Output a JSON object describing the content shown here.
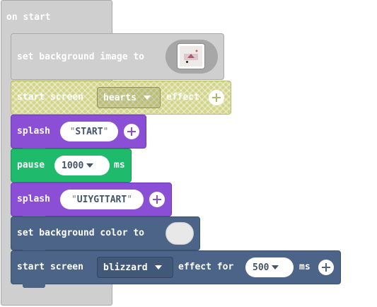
{
  "hat": {
    "label": "on start"
  },
  "blocks": {
    "set_bg_image": {
      "label": "set background image to"
    },
    "start_screen_1": {
      "label": "start screen",
      "effect_value": "hearts",
      "suffix": "effect"
    },
    "splash_1": {
      "label": "splash",
      "value": "START"
    },
    "pause": {
      "label": "pause",
      "value": "1000",
      "unit": "ms"
    },
    "splash_2": {
      "label": "splash",
      "value": "UIYGTTART"
    },
    "set_bg_color": {
      "label": "set background color to"
    },
    "start_screen_2": {
      "label": "start screen",
      "effect_value": "blizzard",
      "middle": "effect for",
      "duration_value": "500",
      "unit": "ms"
    }
  },
  "colors": {
    "gray": "#cfcfcf",
    "yellow_green": "#cfd38a",
    "purple": "#8b4fd6",
    "green": "#1fba6c",
    "slate": "#4b6488"
  }
}
